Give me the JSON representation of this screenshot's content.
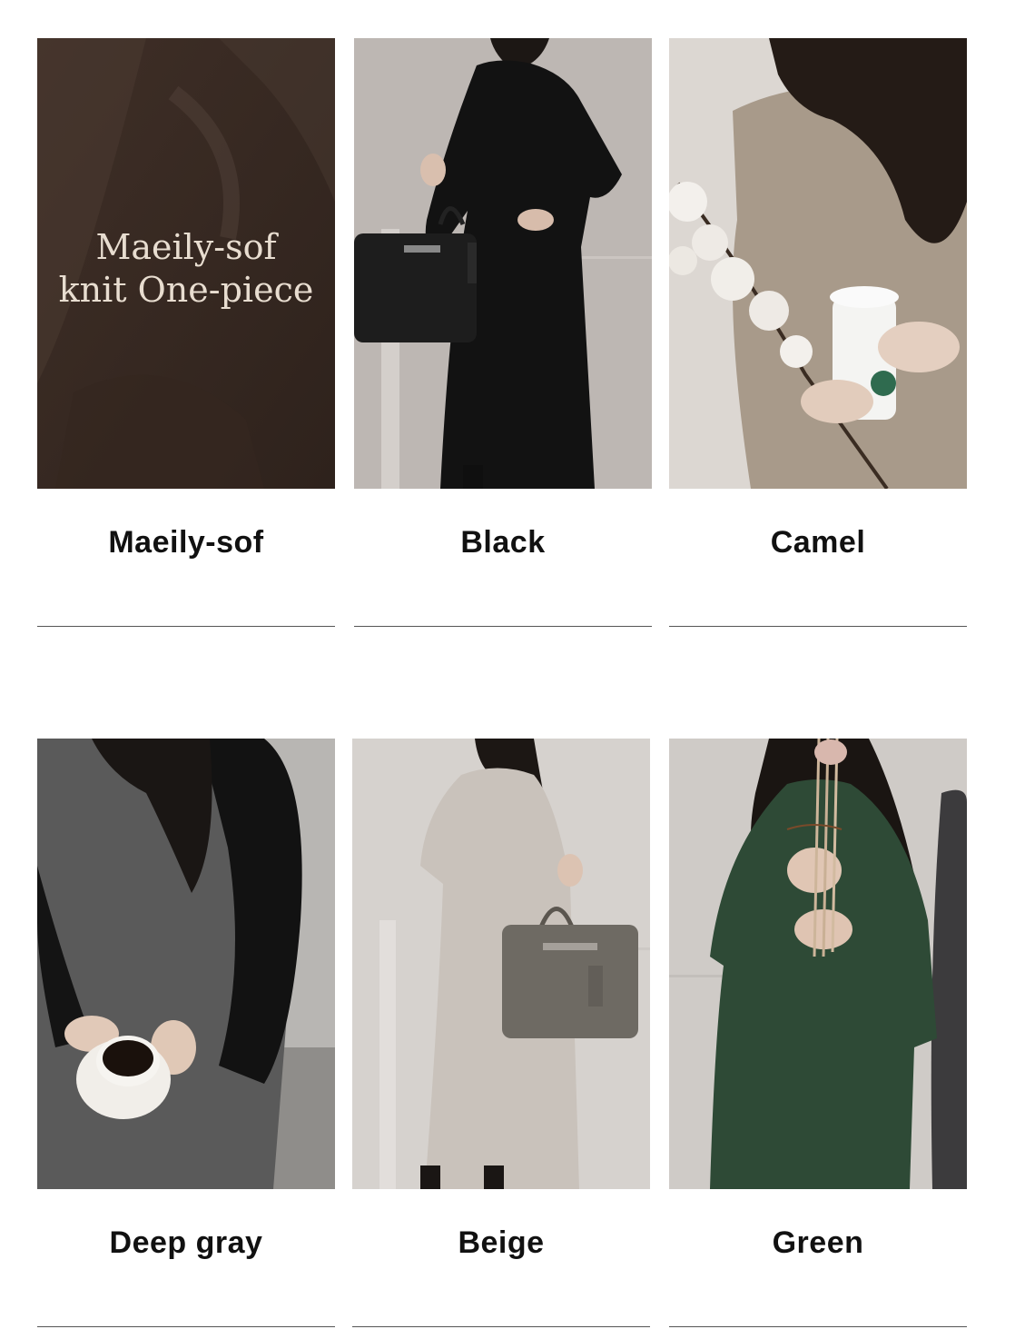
{
  "products": [
    {
      "label": "Maeily-sof",
      "cover_title_line1": "Maeily-sof",
      "cover_title_line2": "knit One-piece"
    },
    {
      "label": "Black"
    },
    {
      "label": "Camel"
    },
    {
      "label": "Deep gray"
    },
    {
      "label": "Beige"
    },
    {
      "label": "Green"
    }
  ],
  "colors": {
    "cover_bg": "#3b2c24",
    "black_dress": "#141414",
    "camel_dress": "#a89a8a",
    "deep_gray_dress": "#5a5a5a",
    "beige_dress": "#c9c2bb",
    "green_dress": "#2e4a36"
  }
}
